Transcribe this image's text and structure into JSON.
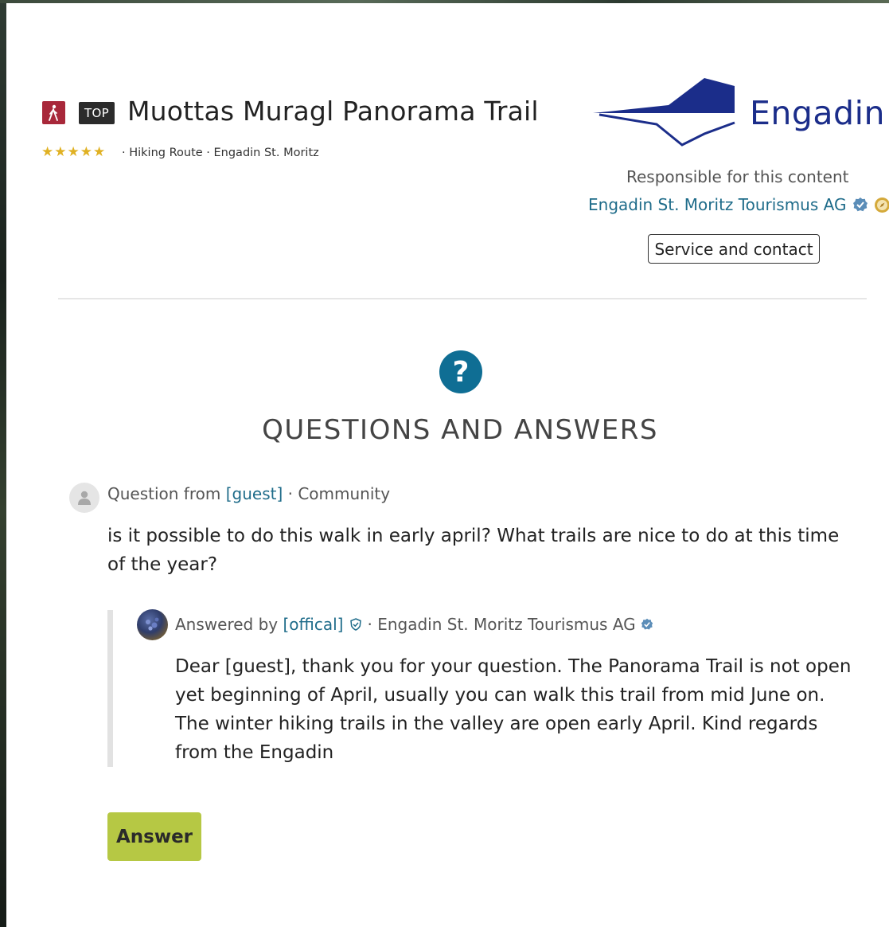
{
  "header": {
    "activity_icon": "hiking-icon",
    "badge": "TOP",
    "title": "Muottas Muragl Panorama Trail",
    "rating_stars": "★★★★★",
    "rating_value": 5,
    "meta": "· Hiking Route · Engadin St. Moritz"
  },
  "publisher": {
    "logo_text": "Engadin",
    "responsible_label": "Responsible for this content",
    "organization": "Engadin St. Moritz Tourismus AG",
    "verified_icon": "verified-badge-icon",
    "partner_icon": "compass-icon",
    "service_button": "Service and contact"
  },
  "qa": {
    "icon": "question-icon",
    "title": "QUESTIONS AND ANSWERS",
    "question": {
      "prefix": "Question from",
      "author": "[guest]",
      "suffix": "· Community",
      "text": "is it possible to do this walk in early april? What trails are nice to do at this time of the year?"
    },
    "answer": {
      "prefix": "Answered by",
      "author": "[offical]",
      "suffix": "· Engadin St. Moritz Tourismus AG",
      "text": "Dear [guest], thank you for your question. The Panorama Trail is not open yet beginning of April, usually you can walk this trail from mid June on. The winter hiking trails in the valley are open early April.  Kind regards from the Engadin"
    },
    "answer_button": "Answer"
  },
  "colors": {
    "accent_blue": "#1f6c8a",
    "brand_red": "#a8283a",
    "answer_green": "#b6c844",
    "logo_blue": "#1b2d8a",
    "star_gold": "#e0b123"
  }
}
